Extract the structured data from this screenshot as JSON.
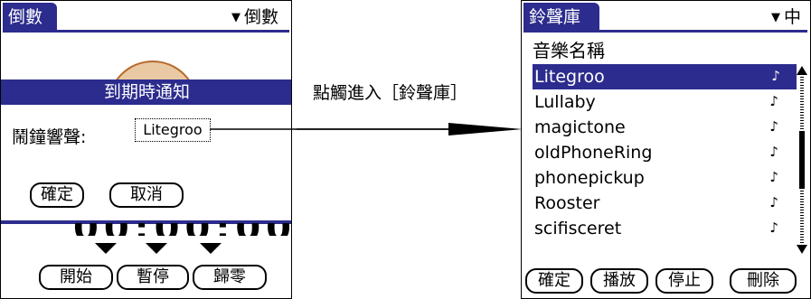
{
  "left": {
    "title": "倒數",
    "menu": "倒數",
    "dialog_title": "到期時通知",
    "alarm_label": "鬧鐘響聲:",
    "alarm_value": "Litegroo",
    "ok": "確定",
    "cancel": "取消",
    "timer": "00:00:00",
    "start": "開始",
    "pause": "暫停",
    "zero": "歸零"
  },
  "annotation": "點觸進入［鈴聲庫］",
  "right": {
    "title": "鈴聲庫",
    "menu": "中",
    "list_header": "音樂名稱",
    "items": [
      "Litegroo",
      "Lullaby",
      "magictone",
      "oldPhoneRing",
      "phonepickup",
      "Rooster",
      "scifisceret"
    ],
    "ok": "確定",
    "play": "播放",
    "stop": "停止",
    "delete": "刪除"
  },
  "icons": {
    "menu_arrow": "triangle-down-icon",
    "music_note": "music-note-icon",
    "timer_arrow": "triangle-down-icon"
  },
  "colors": {
    "title_bar": "#2c2c8e",
    "clock": "#b86a2c"
  }
}
